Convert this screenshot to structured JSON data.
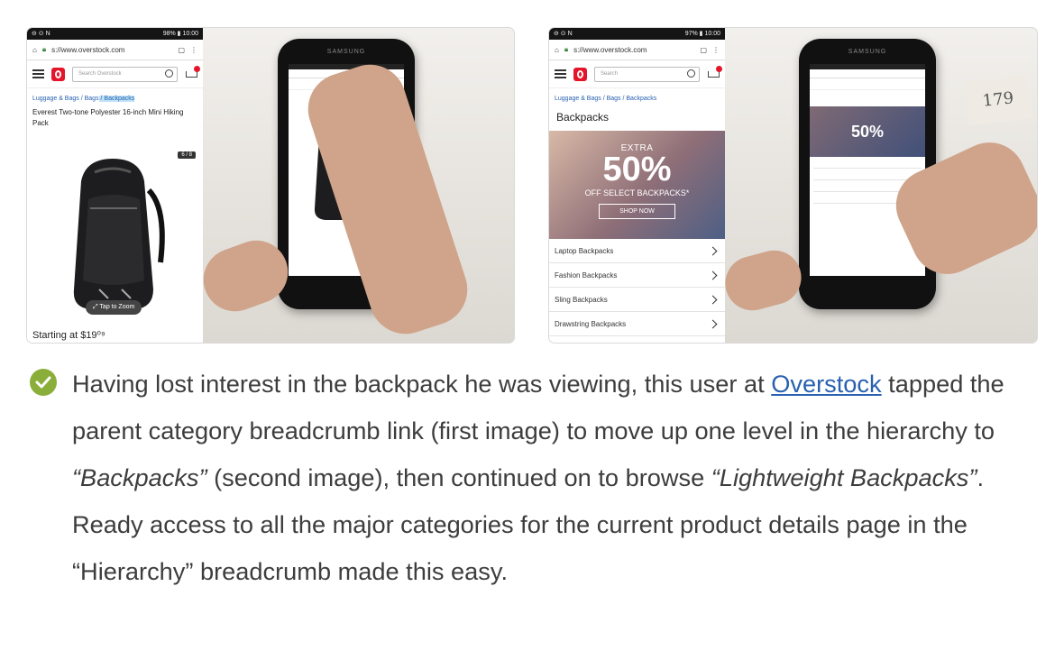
{
  "figure1": {
    "status_left": "⊖ ⊙ N",
    "status_right": "98% ▮ 10:00",
    "url": "s://www.overstock.com",
    "search_placeholder": "Search Overstock",
    "breadcrumb": {
      "part1": "Luggage & Bags",
      "sep1": " / ",
      "part2": "Bags",
      "sep2": " / ",
      "part3": "Backpacks"
    },
    "product_title": "Everest Two-tone Polyester 16-inch Mini Hiking Pack",
    "image_counter": "6 / 8",
    "zoom_label": "Tap to Zoom",
    "price": "Starting at $19⁰⁹",
    "phone_brand": "SAMSUNG"
  },
  "figure2": {
    "status_left": "⊖ ⊙ N",
    "status_right": "97% ▮ 10:00",
    "url": "s://www.overstock.com",
    "search_placeholder": "Search",
    "breadcrumb": "Luggage & Bags  /  Bags  /  Backpacks",
    "category_title": "Backpacks",
    "banner": {
      "line1": "EXTRA",
      "line2": "50%",
      "line3": "OFF SELECT BACKPACKS*",
      "button": "SHOP NOW"
    },
    "categories": [
      "Laptop Backpacks",
      "Fashion Backpacks",
      "Sling Backpacks",
      "Drawstring Backpacks"
    ],
    "phone_brand": "SAMSUNG",
    "note": "179"
  },
  "caption": {
    "part1": "Having lost interest in the backpack he was viewing, this user at ",
    "link": "Overstock",
    "part2": " tapped the parent category breadcrumb link (first image) to move up one level in the hierarchy to ",
    "em1": "“Backpacks”",
    "part3": " (second image), then continued on to browse ",
    "em2": "“Lightweight Backpacks”",
    "part4": ". Ready access to all the major categories for the current product details page in the “Hierarchy” breadcrumb made this easy."
  },
  "colors": {
    "link": "#2961b0",
    "check": "#8bae3b",
    "brand_red": "#e4152b"
  }
}
